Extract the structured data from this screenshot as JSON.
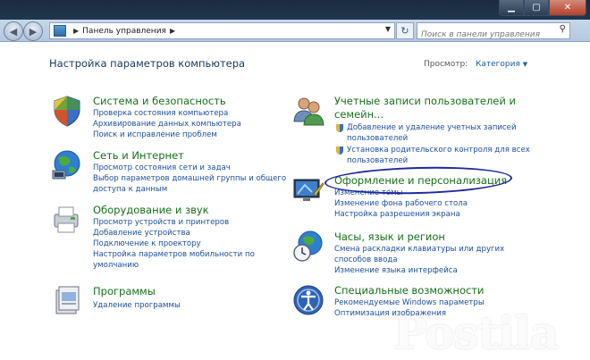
{
  "window": {
    "buttons": {
      "min": "▁",
      "max": "▢",
      "close": "✕"
    }
  },
  "address": {
    "path": "Панель управления",
    "search_placeholder": "Поиск в панели управления"
  },
  "heading": "Настройка параметров компьютера",
  "view": {
    "label": "Просмотр:",
    "value": "Категория"
  },
  "left_categories": [
    {
      "title": "Система и безопасность",
      "icon": "shield-security-icon",
      "links": [
        "Проверка состояния компьютера",
        "Архивирование данных компьютера",
        "Поиск и исправление проблем"
      ]
    },
    {
      "title": "Сеть и Интернет",
      "icon": "network-globe-icon",
      "links": [
        "Просмотр состояния сети и задач",
        "Выбор параметров домашней группы и общего",
        "доступа к данным"
      ]
    },
    {
      "title": "Оборудование и звук",
      "icon": "printer-hardware-icon",
      "links": [
        "Просмотр устройств и принтеров",
        "Добавление устройства",
        "Подключение к проектору",
        "Настройка параметров мобильности по",
        "умолчанию"
      ]
    },
    {
      "title": "Программы",
      "icon": "programs-icon",
      "links": [
        "Удаление программы"
      ]
    }
  ],
  "right_categories": [
    {
      "title_line1": "Учетные записи пользователей и",
      "title_line2": "семейн...",
      "icon": "users-icon",
      "links": [
        "Добавление и удаление учетных записей",
        "пользователей",
        "Установка родительского контроля для всех",
        "пользователей"
      ]
    },
    {
      "title": "Оформление и персонализация",
      "icon": "monitor-appearance-icon",
      "links": [
        "Изменение темы",
        "Изменение фона рабочего стола",
        "Настройка разрешения экрана"
      ]
    },
    {
      "title": "Часы, язык и регион",
      "icon": "clock-globe-icon",
      "links": [
        "Смена раскладки клавиатуры или других",
        "способов ввода",
        "Изменение языка интерфейса"
      ]
    },
    {
      "title": "Специальные возможности",
      "icon": "accessibility-icon",
      "links": [
        "Рекомендуемые Windows параметры",
        "Оптимизация изображения"
      ]
    }
  ],
  "watermark": "Postila"
}
